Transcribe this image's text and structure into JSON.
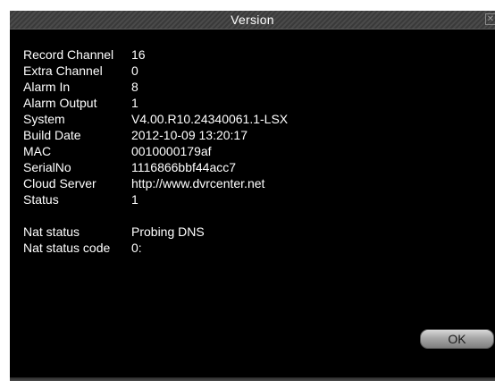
{
  "window": {
    "title": "Version",
    "close_glyph": "✕",
    "ok_label": "OK"
  },
  "info_rows": [
    {
      "label": "Record Channel",
      "value": "16"
    },
    {
      "label": "Extra Channel",
      "value": "0"
    },
    {
      "label": "Alarm In",
      "value": "8"
    },
    {
      "label": "Alarm Output",
      "value": "1"
    },
    {
      "label": "System",
      "value": "V4.00.R10.24340061.1-LSX"
    },
    {
      "label": "Build Date",
      "value": "2012-10-09 13:20:17"
    },
    {
      "label": "MAC",
      "value": "0010000179af"
    },
    {
      "label": "SerialNo",
      "value": "1116866bbf44acc7"
    },
    {
      "label": "Cloud Server",
      "value": "http://www.dvrcenter.net"
    },
    {
      "label": "Status",
      "value": "1"
    }
  ],
  "nat_rows": [
    {
      "label": "Nat status",
      "value": "Probing DNS"
    },
    {
      "label": "Nat status code",
      "value": "0:"
    }
  ],
  "colors": {
    "background": "#000000",
    "text": "#ffffff",
    "titlebar": "#444444"
  }
}
